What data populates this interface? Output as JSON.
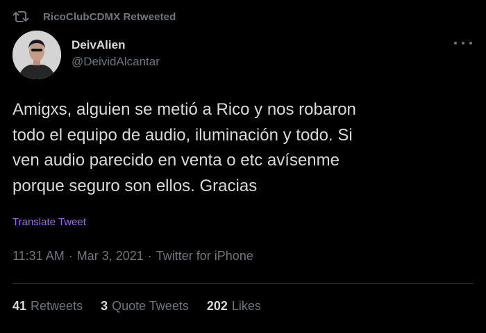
{
  "retweet_context": {
    "text": "RicoClubCDMX Retweeted",
    "icon": "retweet-icon"
  },
  "author": {
    "display_name": "DeivAlien",
    "handle": "@DeividAlcantar"
  },
  "tweet": {
    "text": "Amigxs, alguien se metió a Rico y nos robaron\ntodo el equipo de audio, iluminación y todo. Si\nven audio parecido en venta o etc avísenme\nporque seguro son ellos. Gracias",
    "translate_label": "Translate Tweet"
  },
  "meta": {
    "time": "11:31 AM",
    "date": "Mar 3, 2021",
    "source": "Twitter for iPhone",
    "separator": "·"
  },
  "stats": {
    "retweets": {
      "count": "41",
      "label": "Retweets"
    },
    "quote_tweets": {
      "count": "3",
      "label": "Quote Tweets"
    },
    "likes": {
      "count": "202",
      "label": "Likes"
    }
  },
  "colors": {
    "background": "#000000",
    "text": "#d9d9d9",
    "muted": "#6e767d",
    "translate": "#9f63ff",
    "divider": "#2f3336"
  }
}
